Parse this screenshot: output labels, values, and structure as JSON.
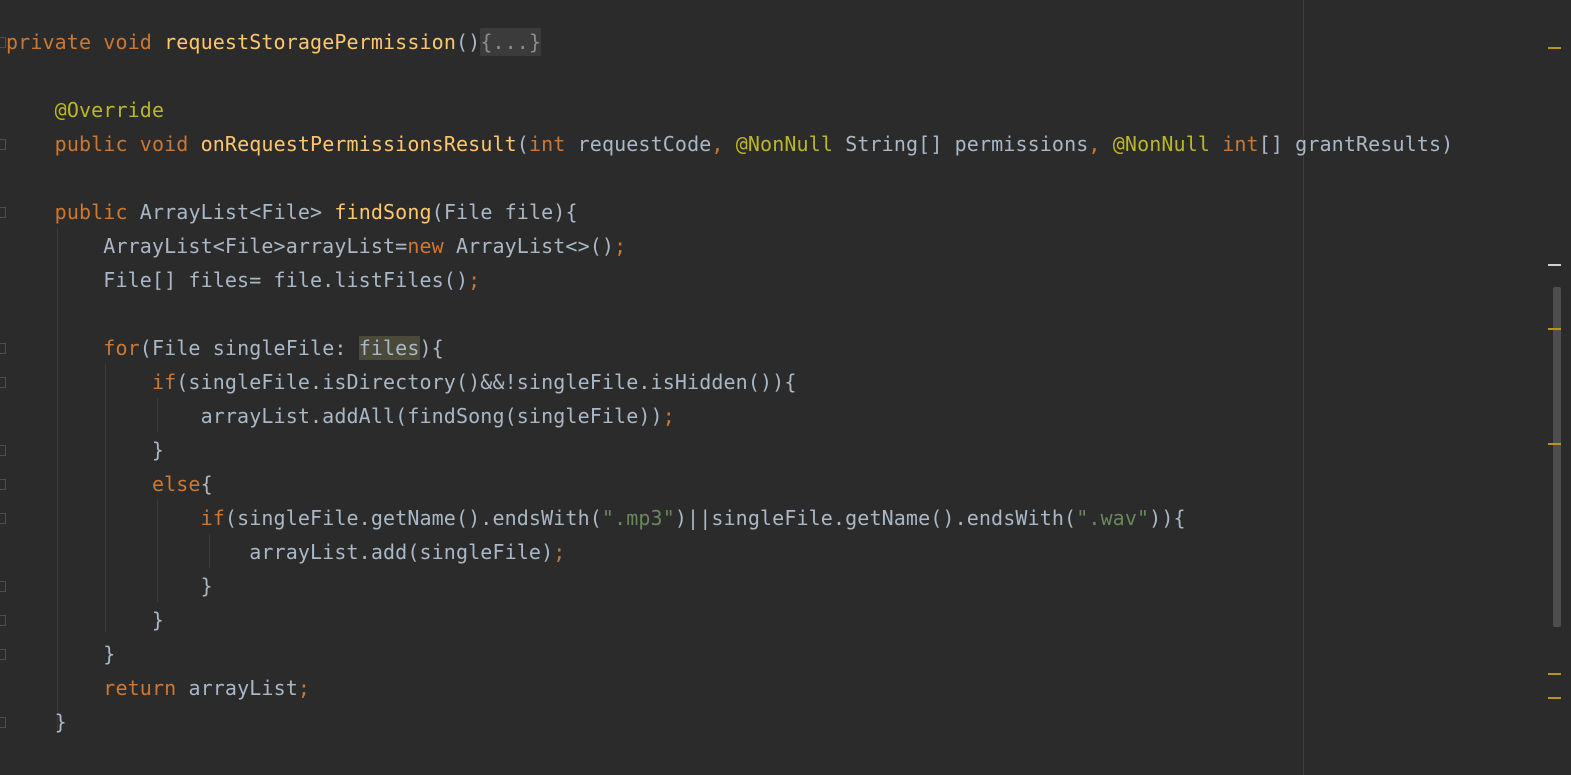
{
  "editor": {
    "language": "Java",
    "lines": [
      {
        "tokens": [
          {
            "t": "private ",
            "c": "kw"
          },
          {
            "t": "void ",
            "c": "kw"
          },
          {
            "t": "requestStoragePermission",
            "c": "fn"
          },
          {
            "t": "()",
            "c": "pl"
          },
          {
            "t": "{...}",
            "c": "folded"
          }
        ]
      },
      {
        "tokens": [
          {
            "t": "    ",
            "c": "pl"
          },
          {
            "t": "@Override",
            "c": "an"
          }
        ]
      },
      {
        "tokens": [
          {
            "t": "    ",
            "c": "pl"
          },
          {
            "t": "public ",
            "c": "kw"
          },
          {
            "t": "void ",
            "c": "kw"
          },
          {
            "t": "onRequestPermissionsResult",
            "c": "fn"
          },
          {
            "t": "(",
            "c": "pl"
          },
          {
            "t": "int ",
            "c": "kw"
          },
          {
            "t": "requestCode",
            "c": "pl"
          },
          {
            "t": ", ",
            "c": "kw"
          },
          {
            "t": "@NonNull ",
            "c": "an"
          },
          {
            "t": "String[] permissions",
            "c": "pl"
          },
          {
            "t": ", ",
            "c": "kw"
          },
          {
            "t": "@NonNull ",
            "c": "an"
          },
          {
            "t": "int",
            "c": "kw"
          },
          {
            "t": "[] grantResults)",
            "c": "pl"
          }
        ]
      },
      {
        "tokens": [
          {
            "t": "    ",
            "c": "pl"
          },
          {
            "t": "public ",
            "c": "kw"
          },
          {
            "t": "ArrayList<File> ",
            "c": "pl"
          },
          {
            "t": "findSong",
            "c": "fn"
          },
          {
            "t": "(File file){",
            "c": "pl"
          }
        ]
      },
      {
        "tokens": [
          {
            "t": "        ArrayList<File>arrayList=",
            "c": "pl"
          },
          {
            "t": "new ",
            "c": "kw"
          },
          {
            "t": "ArrayList<>()",
            "c": "pl"
          },
          {
            "t": ";",
            "c": "kw"
          }
        ]
      },
      {
        "tokens": [
          {
            "t": "        File[] files= file.listFiles()",
            "c": "pl"
          },
          {
            "t": ";",
            "c": "kw"
          }
        ]
      },
      {
        "tokens": [
          {
            "t": "        ",
            "c": "pl"
          },
          {
            "t": "for",
            "c": "kw"
          },
          {
            "t": "(File singleFile: ",
            "c": "pl"
          },
          {
            "t": "files",
            "c": "hl"
          },
          {
            "t": "){",
            "c": "pl"
          }
        ]
      },
      {
        "tokens": [
          {
            "t": "            ",
            "c": "pl"
          },
          {
            "t": "if",
            "c": "kw"
          },
          {
            "t": "(singleFile.isDirectory()&&!singleFile.isHidden()){",
            "c": "pl"
          }
        ]
      },
      {
        "tokens": [
          {
            "t": "                arrayList.addAll(findSong(singleFile))",
            "c": "pl"
          },
          {
            "t": ";",
            "c": "kw"
          }
        ]
      },
      {
        "tokens": [
          {
            "t": "            }",
            "c": "pl"
          }
        ]
      },
      {
        "tokens": [
          {
            "t": "            ",
            "c": "pl"
          },
          {
            "t": "else",
            "c": "kw"
          },
          {
            "t": "{",
            "c": "pl"
          }
        ]
      },
      {
        "tokens": [
          {
            "t": "                ",
            "c": "pl"
          },
          {
            "t": "if",
            "c": "kw"
          },
          {
            "t": "(singleFile.getName().endsWith(",
            "c": "pl"
          },
          {
            "t": "\".mp3\"",
            "c": "str"
          },
          {
            "t": ")||singleFile.getName().endsWith(",
            "c": "pl"
          },
          {
            "t": "\".wav\"",
            "c": "str"
          },
          {
            "t": ")){",
            "c": "pl"
          }
        ]
      },
      {
        "tokens": [
          {
            "t": "                    arrayList.add(singleFile)",
            "c": "pl"
          },
          {
            "t": ";",
            "c": "kw"
          }
        ]
      },
      {
        "tokens": [
          {
            "t": "                }",
            "c": "pl"
          }
        ]
      },
      {
        "tokens": [
          {
            "t": "            }",
            "c": "pl"
          }
        ]
      },
      {
        "tokens": [
          {
            "t": "        }",
            "c": "pl"
          }
        ]
      },
      {
        "tokens": [
          {
            "t": "        ",
            "c": "pl"
          },
          {
            "t": "return ",
            "c": "kw"
          },
          {
            "t": "arrayList",
            "c": "pl"
          },
          {
            "t": ";",
            "c": "kw"
          }
        ]
      },
      {
        "tokens": [
          {
            "t": "    }",
            "c": "pl"
          }
        ]
      }
    ]
  },
  "colors": {
    "background": "#2b2b2b",
    "keyword": "#cc7832",
    "function": "#ffc66d",
    "annotation": "#bbb529",
    "string": "#6a8759",
    "plain": "#a9b7c6",
    "usage_highlight": "#4b4a3a",
    "warning_stripe": "#be9117"
  }
}
